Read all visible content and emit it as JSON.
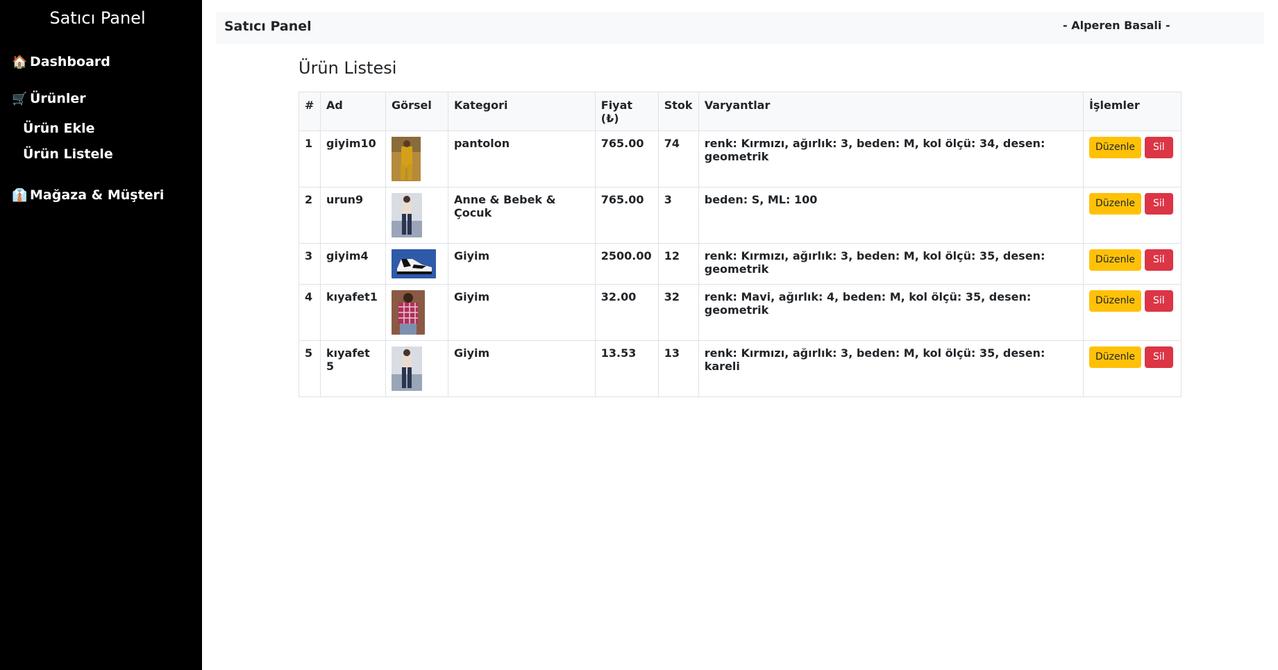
{
  "sidebar": {
    "title": "Satıcı Panel",
    "items": [
      {
        "icon": "🏠",
        "label": "Dashboard"
      },
      {
        "icon": "🛒",
        "label": "Ürünler"
      },
      {
        "label": "Ürün Ekle"
      },
      {
        "label": "Ürün Listele"
      },
      {
        "icon": "👔",
        "label": "Mağaza & Müşteri"
      }
    ]
  },
  "topbar": {
    "title": "Satıcı Panel",
    "user": "- Alperen Basali -"
  },
  "main": {
    "title": "Ürün Listesi",
    "table": {
      "headers": [
        "#",
        "Ad",
        "Görsel",
        "Kategori",
        "Fiyat (₺)",
        "Stok",
        "Varyantlar",
        "İşlemler"
      ],
      "rows": [
        {
          "id": "1",
          "name": "giyim10",
          "image": "yellow-outfit-photo",
          "category": "pantolon",
          "price": "765.00",
          "stock": "74",
          "variants": "renk: Kırmızı, ağırlık: 3, beden: M, kol ölçü: 34, desen: geometrik"
        },
        {
          "id": "2",
          "name": "urun9",
          "image": "jeans-outfit-photo",
          "category": "Anne & Bebek & Çocuk",
          "price": "765.00",
          "stock": "3",
          "variants": "beden: S, ML: 100"
        },
        {
          "id": "3",
          "name": "giyim4",
          "image": "sneaker-photo",
          "category": "Giyim",
          "price": "2500.00",
          "stock": "12",
          "variants": "renk: Kırmızı, ağırlık: 3, beden: M, kol ölçü: 35, desen: geometrik"
        },
        {
          "id": "4",
          "name": "kıyafet1",
          "image": "plaid-shirt-photo",
          "category": "Giyim",
          "price": "32.00",
          "stock": "32",
          "variants": "renk: Mavi, ağırlık: 4, beden: M, kol ölçü: 35, desen: geometrik"
        },
        {
          "id": "5",
          "name": "kıyafet 5",
          "image": "jeans-outfit-photo",
          "category": "Giyim",
          "price": "13.53",
          "stock": "13",
          "variants": "renk: Kırmızı, ağırlık: 3, beden: M, kol ölçü: 35, desen: kareli"
        }
      ],
      "edit_label": "Düzenle",
      "delete_label": "Sil"
    }
  },
  "colors": {
    "sidebar_bg": "#000000",
    "edit_button": "#ffc107",
    "delete_button": "#dc3545",
    "header_bg": "#f8f9fa"
  }
}
